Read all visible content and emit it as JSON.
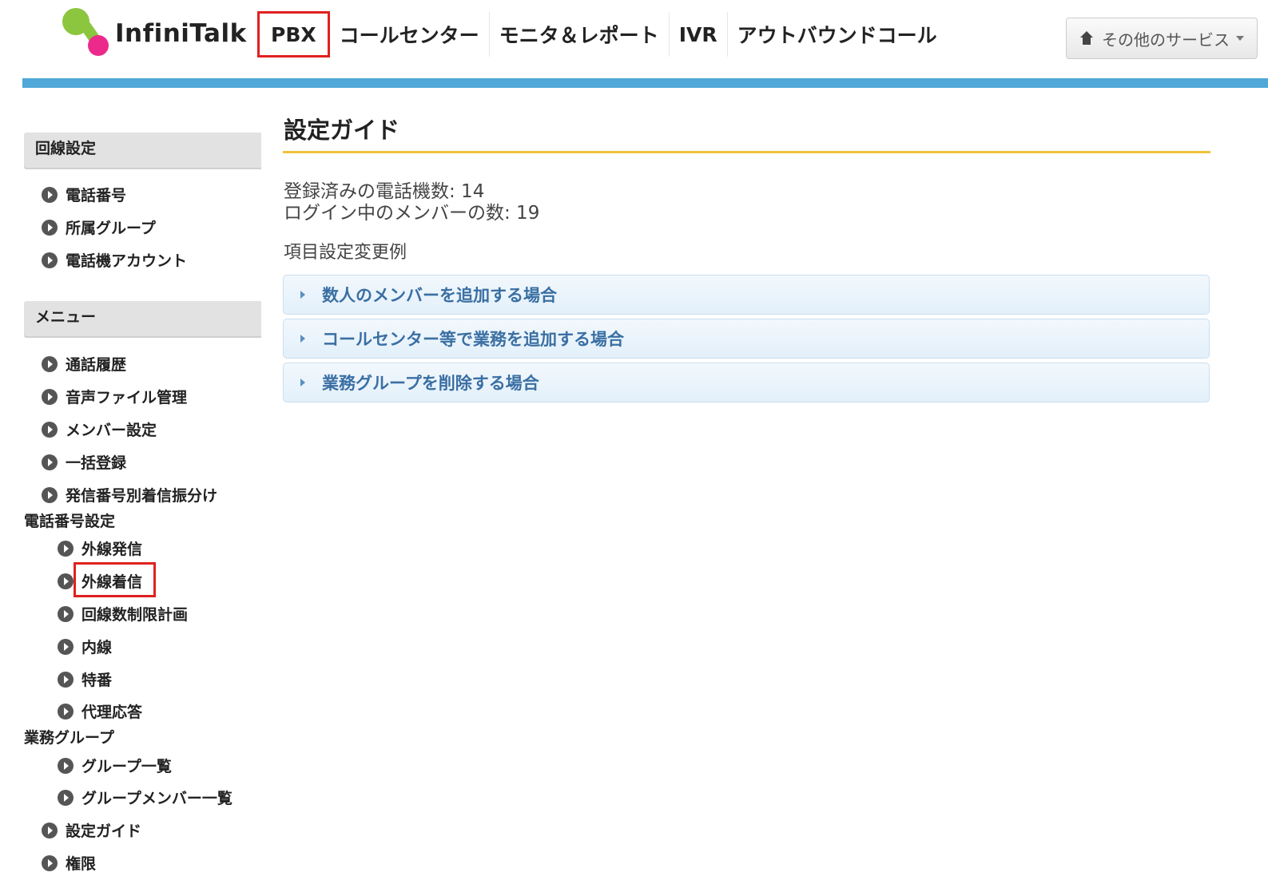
{
  "header": {
    "logo_text": "InfiniTalk",
    "nav": [
      "PBX",
      "コールセンター",
      "モニタ＆レポート",
      "IVR",
      "アウトバウンドコール"
    ],
    "other_services": "その他のサービス"
  },
  "sidebar": {
    "section1_title": "回線設定",
    "section1_items": [
      "電話番号",
      "所属グループ",
      "電話機アカウント"
    ],
    "section2_title": "メニュー",
    "menu_items": [
      "通話履歴",
      "音声ファイル管理",
      "メンバー設定",
      "一括登録",
      "発信番号別着信振分け"
    ],
    "phone_settings_label": "電話番号設定",
    "phone_settings_items": [
      "外線発信",
      "外線着信",
      "回線数制限計画",
      "内線",
      "特番",
      "代理応答"
    ],
    "group_label": "業務グループ",
    "group_items": [
      "グループ一覧",
      "グループメンバー一覧"
    ],
    "tail_items": [
      "設定ガイド",
      "権限"
    ]
  },
  "main": {
    "title": "設定ガイド",
    "registered_phones": "登録済みの電話機数: 14",
    "logged_in_members": "ログイン中のメンバーの数: 19",
    "examples_label": "項目設定変更例",
    "accordion": [
      "数人のメンバーを追加する場合",
      "コールセンター等で業務を追加する場合",
      "業務グループを削除する場合"
    ]
  },
  "colors": {
    "accent_bar": "#4fa8d8",
    "title_rule": "#f0c23c",
    "highlight": "#e02020",
    "logo_green": "#8cc63f",
    "logo_pink": "#ec2a8c"
  }
}
